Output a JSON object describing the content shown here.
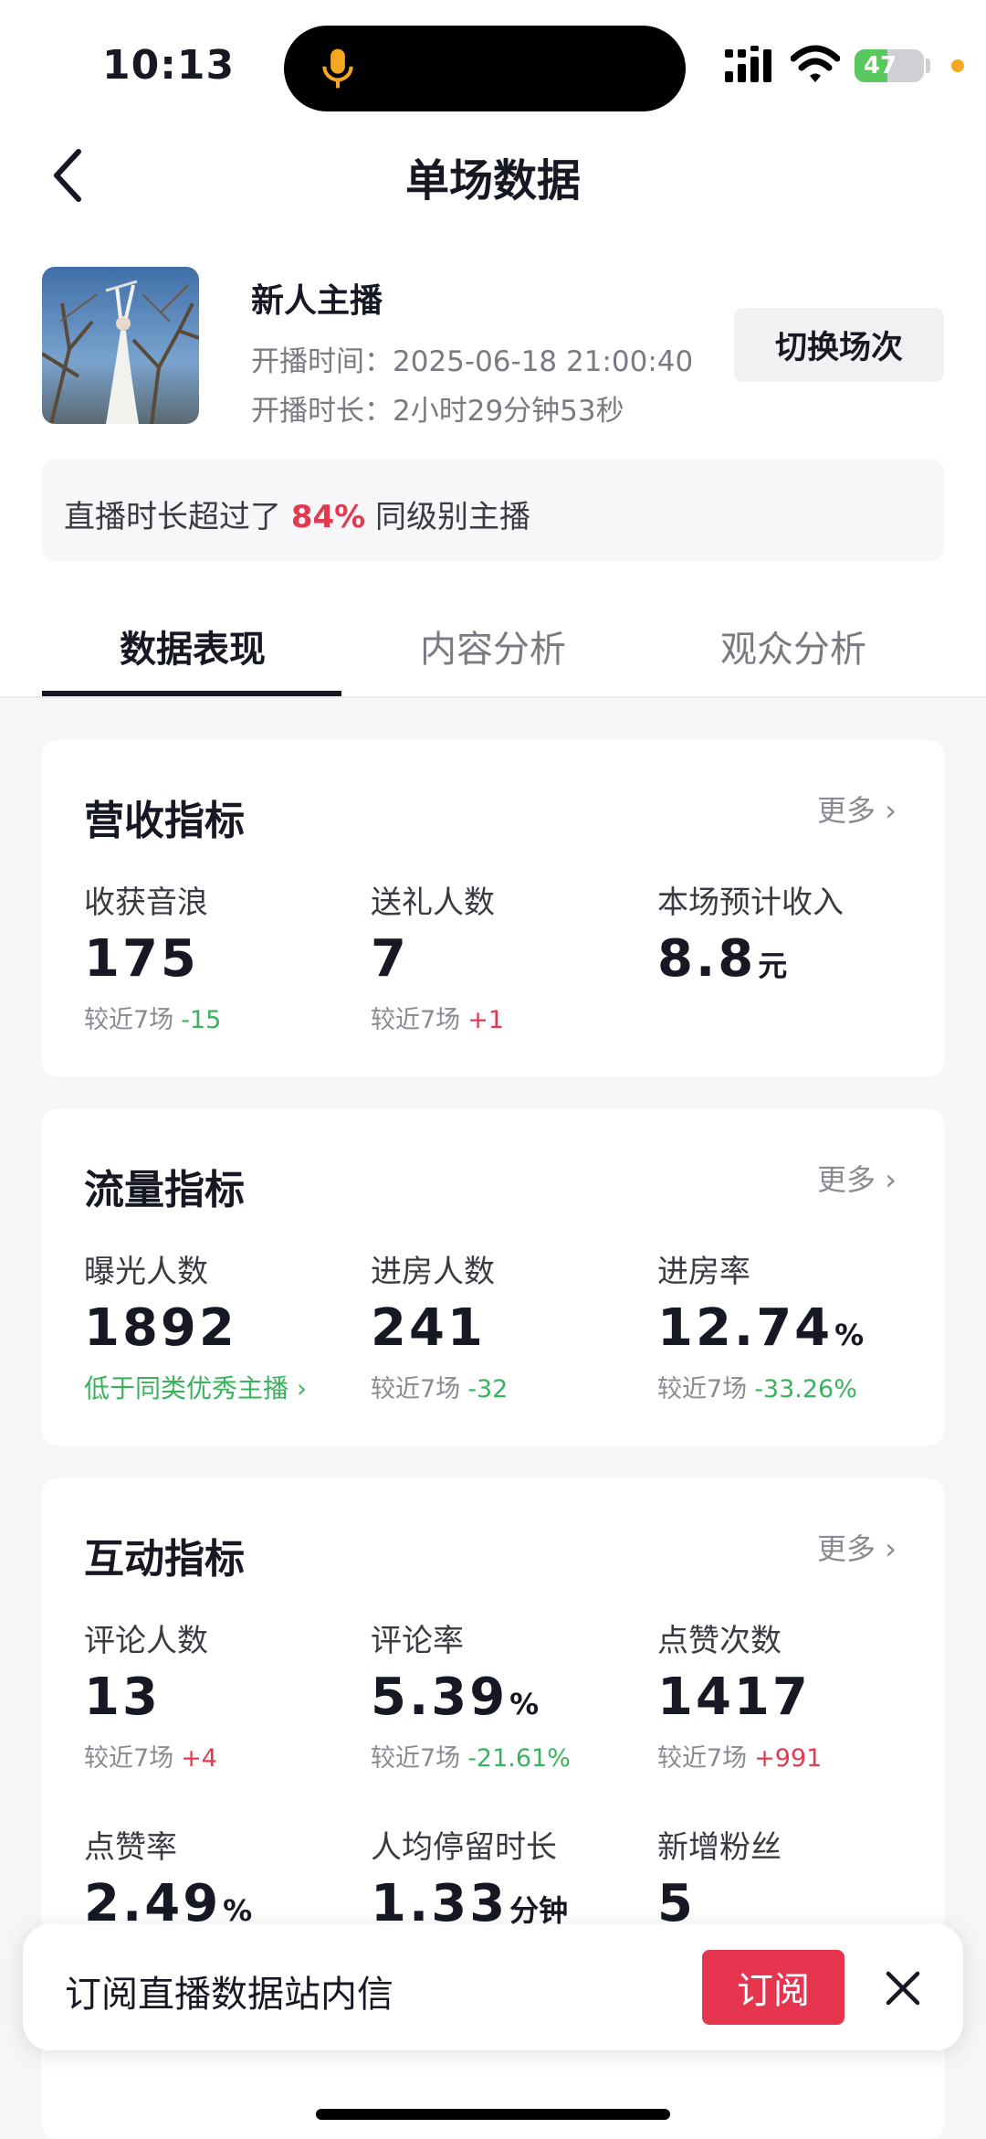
{
  "status_bar": {
    "time": "10:13",
    "battery": "47",
    "battery_level": 0.47
  },
  "nav": {
    "title": "单场数据"
  },
  "stream": {
    "anchor_name": "新人主播",
    "start_time": "开播时间：2025-06-18 21:00:40",
    "duration": "开播时长：2小时29分钟53秒",
    "switch_label": "切换场次"
  },
  "rank": {
    "prefix": "直播时长超过了",
    "percent": "84%",
    "suffix": "同级别主播"
  },
  "tabs": [
    "数据表现",
    "内容分析",
    "观众分析"
  ],
  "more_label": "更多",
  "cards": {
    "revenue": {
      "title": "营收指标",
      "metrics": [
        {
          "label": "收获音浪",
          "value": "175",
          "cmp_label": "较近7场",
          "cmp_value": "-15"
        },
        {
          "label": "送礼人数",
          "value": "7",
          "cmp_label": "较近7场",
          "cmp_value": "+1"
        },
        {
          "label": "本场预计收入",
          "value": "8.8",
          "unit": "元"
        }
      ]
    },
    "traffic": {
      "title": "流量指标",
      "metrics": [
        {
          "label": "曝光人数",
          "value": "1892",
          "link": "低于同类优秀主播"
        },
        {
          "label": "进房人数",
          "value": "241",
          "cmp_label": "较近7场",
          "cmp_value": "-32"
        },
        {
          "label": "进房率",
          "value": "12.74",
          "unit": "%",
          "cmp_label": "较近7场",
          "cmp_value": "-33.26%"
        }
      ]
    },
    "interaction": {
      "title": "互动指标",
      "metrics": [
        {
          "label": "评论人数",
          "value": "13",
          "cmp_label": "较近7场",
          "cmp_value": "+4"
        },
        {
          "label": "评论率",
          "value": "5.39",
          "unit": "%",
          "cmp_label": "较近7场",
          "cmp_value": "-21.61%"
        },
        {
          "label": "点赞次数",
          "value": "1417",
          "cmp_label": "较近7场",
          "cmp_value": "+991"
        },
        {
          "label": "点赞率",
          "value": "2.49",
          "unit": "%"
        },
        {
          "label": "人均停留时长",
          "value": "1.33",
          "unit": "分钟"
        },
        {
          "label": "新增粉丝",
          "value": "5"
        }
      ]
    }
  },
  "popup": {
    "text": "订阅直播数据站内信",
    "button": "订阅"
  },
  "colors": {
    "accent_red": "#e6354f",
    "up": "#e03a50",
    "down": "#38b35c"
  }
}
